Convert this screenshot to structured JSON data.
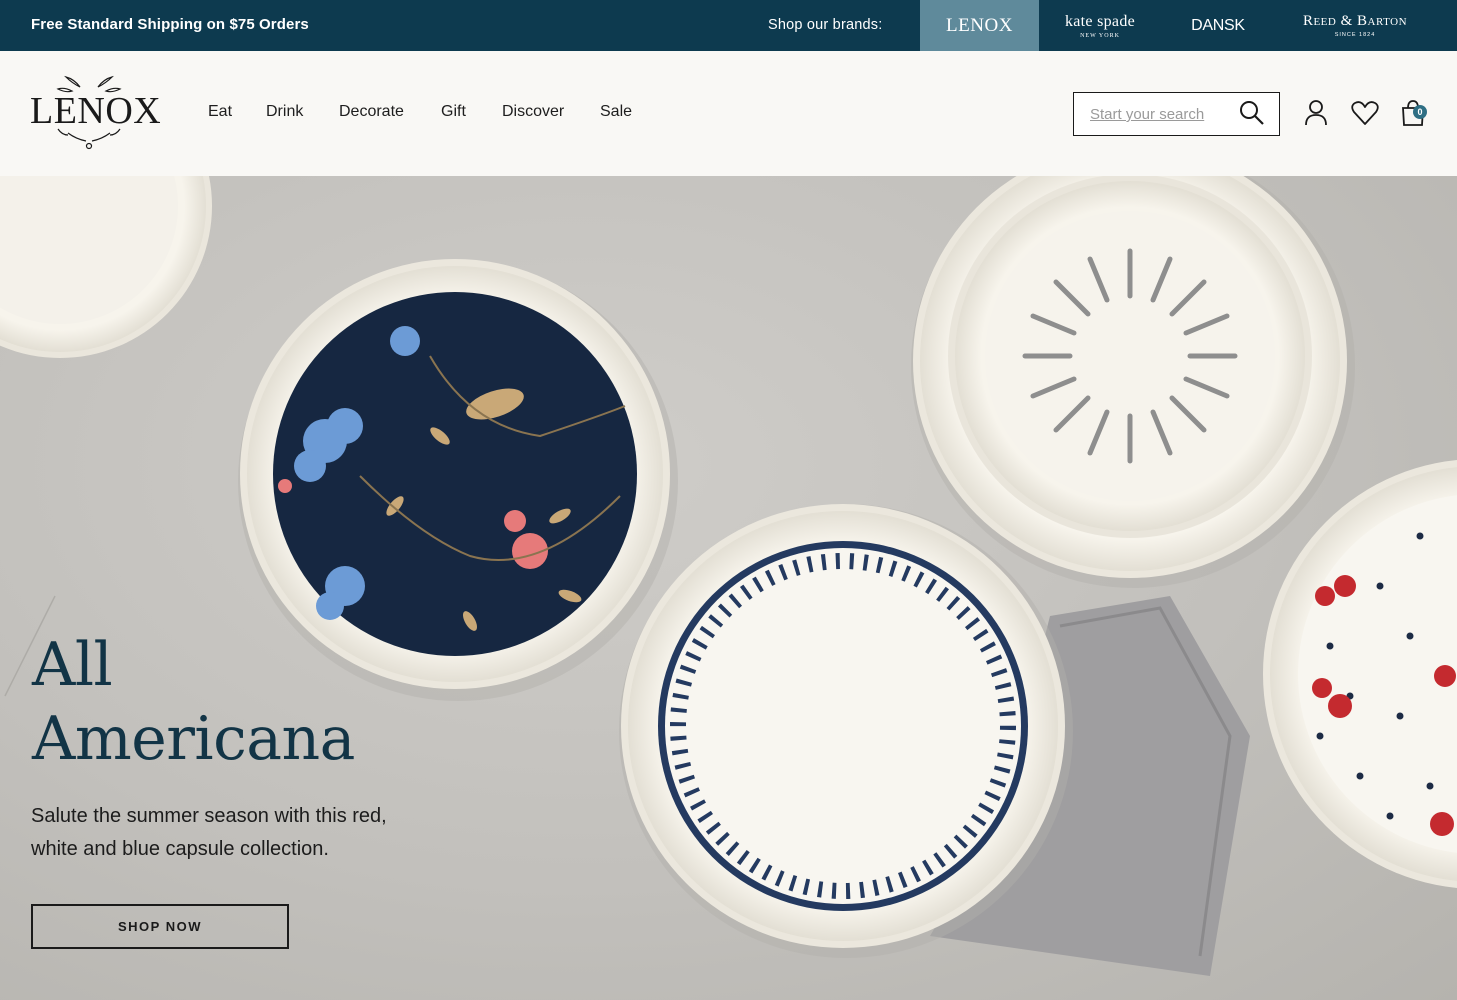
{
  "topbar": {
    "shipping_text": "Free Standard Shipping on $75 Orders",
    "brands_label": "Shop our brands:",
    "brands": {
      "lenox": "LENOX",
      "kate": "kate spade",
      "kate_sub": "NEW YORK",
      "dansk": "DANSK",
      "reed": "Reed & Barton",
      "reed_sub": "SINCE 1824"
    }
  },
  "header": {
    "logo_text": "LENOX",
    "nav": [
      "Eat",
      "Drink",
      "Decorate",
      "Gift",
      "Discover",
      "Sale"
    ],
    "search_placeholder": "Start your search",
    "cart_count": "0"
  },
  "hero": {
    "title_line1": "All",
    "title_line2": "Americana",
    "subtitle": "Salute the summer season with this red, white and blue capsule collection.",
    "cta": "SHOP NOW"
  },
  "colors": {
    "topbar_bg": "#0d3a4f",
    "active_brand_bg": "#5f8a9b",
    "title_color": "#123446",
    "cart_badge": "#2f6f84"
  }
}
